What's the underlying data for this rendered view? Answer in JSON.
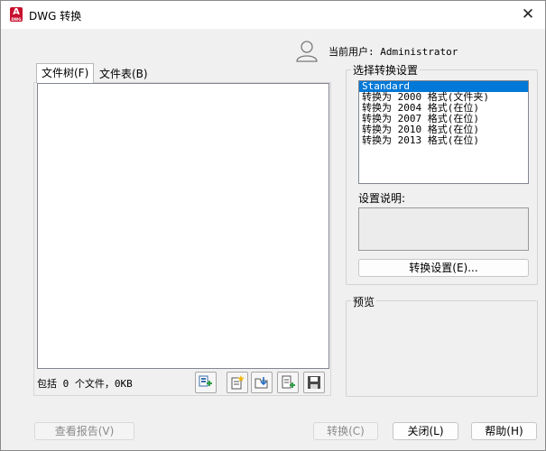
{
  "window": {
    "title": "DWG 转换",
    "close_glyph": "✕",
    "app_icon_letter": "A",
    "app_icon_sub": "DWG"
  },
  "user": {
    "label": "当前用户: Administrator"
  },
  "tabs": [
    {
      "label": "文件树(F)",
      "active": true
    },
    {
      "label": "文件表(B)",
      "active": false
    }
  ],
  "status": {
    "file_count": "包括 0 个文件，0KB"
  },
  "toolbar": [
    {
      "icon": "add-files-icon"
    },
    {
      "icon": "new-list-icon"
    },
    {
      "icon": "open-folder-icon"
    },
    {
      "icon": "append-list-icon"
    },
    {
      "icon": "save-list-icon"
    }
  ],
  "settings": {
    "group_title": "选择转换设置",
    "items": [
      "Standard",
      "转换为 2000 格式(文件夹)",
      "转换为 2004 格式(在位)",
      "转换为 2007 格式(在位)",
      "转换为 2010 格式(在位)",
      "转换为 2013 格式(在位)"
    ],
    "selected_index": 0,
    "description_label": "设置说明:",
    "description": "",
    "button_label": "转换设置(E)..."
  },
  "preview": {
    "group_title": "预览"
  },
  "footer": {
    "report_label": "查看报告(V)",
    "convert_label": "转换(C)",
    "close_label": "关闭(L)",
    "help_label": "帮助(H)"
  },
  "colors": {
    "accent": "#0078d7",
    "app_icon": "#c8102e"
  }
}
